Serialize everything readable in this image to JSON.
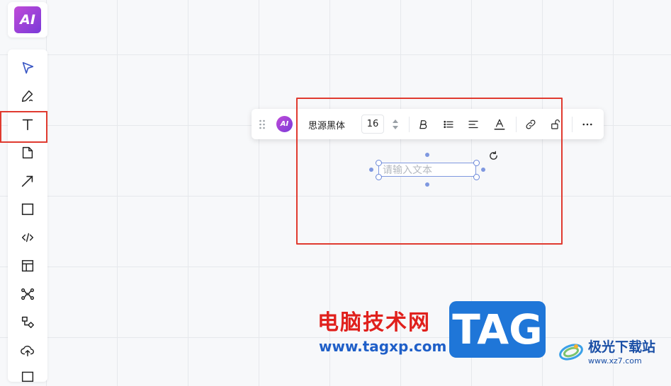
{
  "app": {
    "logo_text": "AI"
  },
  "left_toolbar": {
    "tools": [
      {
        "name": "select-tool",
        "icon": "cursor-arrow-icon"
      },
      {
        "name": "pen-tool",
        "icon": "pen-icon"
      },
      {
        "name": "text-tool",
        "icon": "text-t-icon",
        "highlighted": true
      },
      {
        "name": "sticky-note-tool",
        "icon": "note-icon"
      },
      {
        "name": "arrow-tool",
        "icon": "arrow-icon"
      },
      {
        "name": "rectangle-tool",
        "icon": "square-icon"
      },
      {
        "name": "code-tool",
        "icon": "code-icon"
      },
      {
        "name": "layout-tool",
        "icon": "layout-icon"
      },
      {
        "name": "mindmap-tool",
        "icon": "mindmap-icon"
      },
      {
        "name": "flowchart-tool",
        "icon": "flowchart-icon"
      },
      {
        "name": "upload-tool",
        "icon": "upload-cloud-icon"
      }
    ]
  },
  "format_bar": {
    "ai_label": "AI",
    "font_name": "思源黑体",
    "font_size": "16",
    "buttons": [
      "bold-icon",
      "bullet-list-icon",
      "align-icon",
      "text-color-icon",
      "link-icon",
      "lock-icon",
      "more-icon"
    ]
  },
  "text_box": {
    "placeholder": "请输入文本"
  },
  "watermark": {
    "cn_title": "电脑技术网",
    "url": "www.tagxp.com",
    "tag": "TAG",
    "site_name": "极光下载站",
    "site_url": "www.xz7.com"
  },
  "colors": {
    "highlight": "#e03a2f",
    "selection": "#7f98e0",
    "ai_gradient_start": "#c04bd8",
    "ai_gradient_end": "#7a3ad8"
  }
}
